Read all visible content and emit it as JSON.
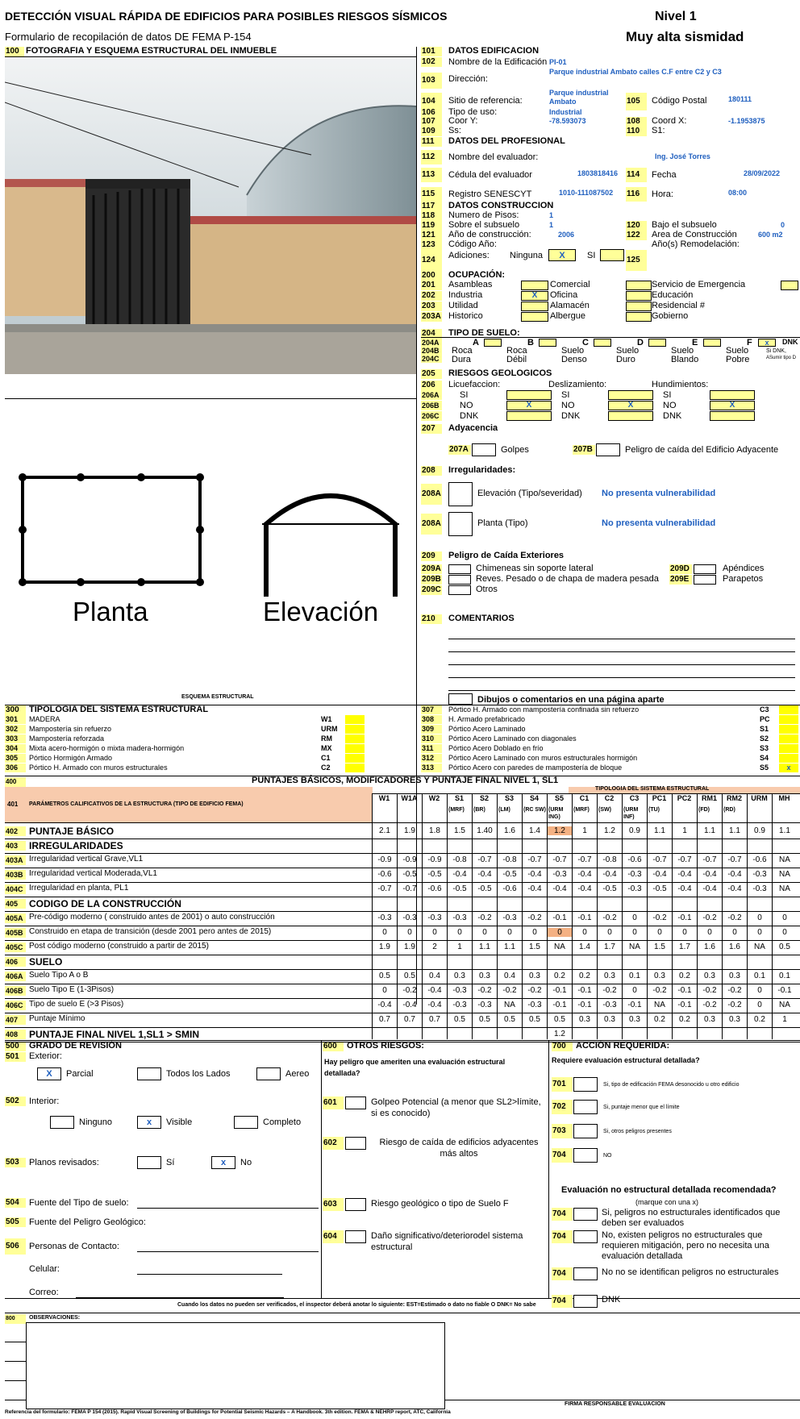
{
  "header": {
    "title": "DETECCIÓN VISUAL RÁPIDA DE EDIFICIOS PARA POSIBLES RIESGOS SÍSMICOS",
    "subtitle": "Formulario de recopilación de datos DE FEMA P-154",
    "level": "Nivel 1",
    "seismicity": "Muy alta sismidad"
  },
  "s100": {
    "num": "100",
    "label": "FOTOGRAFIA Y ESQUEMA ESTRUCTURAL DEL INMUEBLE"
  },
  "sketch": {
    "planta": "Planta",
    "elevacion": "Elevación",
    "caption": "ESQUEMA ESTRUCTURAL"
  },
  "building": {
    "r101": {
      "num": "101",
      "label": "DATOS EDIFICACION"
    },
    "r102": {
      "num": "102",
      "label": "Nombre de la Edificación",
      "value": "PI-01"
    },
    "r103": {
      "num": "103",
      "label": "Dirección:",
      "value": "Parque industrial Ambato calles C.F entre  C2 y C3"
    },
    "r104": {
      "num": "104",
      "label": "Sitio de referencia:",
      "value": "Parque industrial Ambato"
    },
    "r105": {
      "num": "105",
      "label": "Código Postal",
      "value": "180111"
    },
    "r106": {
      "num": "106",
      "label": "Tipo de uso:",
      "value": "Industrial"
    },
    "r107": {
      "num": "107",
      "label": "Coor Y:",
      "value": "-78.593073"
    },
    "r108": {
      "num": "108",
      "label": "Coord X:",
      "value": "-1.1953875"
    },
    "r109": {
      "num": "109",
      "label": "Ss:"
    },
    "r110": {
      "num": "110",
      "label": "S1:"
    }
  },
  "prof": {
    "r111": {
      "num": "111",
      "label": "DATOS DEL PROFESIONAL"
    },
    "r112": {
      "num": "112",
      "label": "Nombre del evaluador:",
      "value": "Ing. José Torres"
    },
    "r113": {
      "num": "113",
      "label": "Cédula del evaluador",
      "value": "1803818416"
    },
    "r114": {
      "num": "114",
      "label": "Fecha",
      "value": "28/09/2022"
    },
    "r115": {
      "num": "115",
      "label": "Registro SENESCYT",
      "value": "1010-111087502"
    },
    "r116": {
      "num": "116",
      "label": "Hora:",
      "value": "08:00"
    }
  },
  "constr": {
    "r117": {
      "num": "117",
      "label": "DATOS CONSTRUCCION"
    },
    "r118": {
      "num": "118",
      "label": "Numero de Pisos:",
      "value": "1"
    },
    "r119": {
      "num": "119",
      "label": "Sobre el subsuelo",
      "value": "1"
    },
    "r120": {
      "num": "120",
      "label": "Bajo el subsuelo",
      "value": "0"
    },
    "r121": {
      "num": "121",
      "label": "Año de construcción:",
      "value": "2006"
    },
    "r122": {
      "num": "122",
      "label": "Area de Construcción",
      "value": "600 m2"
    },
    "r123": {
      "num": "123",
      "label": "Código Año:",
      "extra": "Año(s) Remodelación:"
    },
    "r124": {
      "num": "124",
      "label": "Adiciones:",
      "opt1": "Ninguna",
      "mark1": "X",
      "opt2": "SI"
    },
    "r125": {
      "num": "125"
    }
  },
  "occ": {
    "r200": {
      "num": "200",
      "label": "OCUPACIÓN:"
    },
    "rows": [
      {
        "num": "201",
        "c1": "Asambleas",
        "m1": "",
        "c2": "Comercial",
        "m2": "",
        "c3": "Servicio de  Emergencia"
      },
      {
        "num": "202",
        "c1": "Industria",
        "m1": "X",
        "c2": "Oficina",
        "m2": "",
        "c3": "Educación"
      },
      {
        "num": "203",
        "c1": "Utilidad",
        "m1": "",
        "c2": "Alamacén",
        "m2": "",
        "c3": "Residencial #"
      },
      {
        "num": "203A",
        "c1": "Historico",
        "m1": "",
        "c2": "Albergue",
        "m2": "",
        "c3": "Gobierno"
      }
    ]
  },
  "soil": {
    "r204": {
      "num": "204",
      "label": "TIPO DE SUELO:"
    },
    "nums": [
      "204A",
      "204B",
      "204C"
    ],
    "letters": [
      "A",
      "B",
      "C",
      "D",
      "E",
      "F"
    ],
    "l1": [
      "Roca",
      "Roca",
      "Suelo",
      "Suelo",
      "Suelo",
      "Suelo"
    ],
    "l2": [
      "Dura",
      "Débil",
      "Denso",
      "Duro",
      "Blando",
      "Pobre"
    ],
    "mark": "x",
    "dnk": "DNK",
    "note1": "Si DNK,",
    "note2": "ASumir tipo D"
  },
  "geo": {
    "r205": {
      "num": "205",
      "label": "RIESGOS GEOLOGICOS"
    },
    "r206": {
      "num": "206",
      "h1": "Licuefaccion:",
      "h2": "Deslizamiento:",
      "h3": "Hundimientos:"
    },
    "rows": [
      {
        "num": "206A",
        "v": "SI",
        "m": ""
      },
      {
        "num": "206B",
        "v": "NO",
        "m": "X"
      },
      {
        "num": "206C",
        "v": "DNK",
        "m": ""
      }
    ]
  },
  "adj": {
    "r207": {
      "num": "207",
      "label": "Adyacencia"
    },
    "a": "207A",
    "alabel": "Golpes",
    "b": "207B",
    "blabel": "Peligro de caída del Edificio Adyacente"
  },
  "irr": {
    "r208": {
      "num": "208",
      "label": "Irregularidades:"
    },
    "n1": "208A",
    "l1": "Elevación (Tipo/severidad)",
    "v1": "No presenta vulnerabilidad",
    "n2": "208A",
    "l2": "Planta (Tipo)",
    "v2": "No presenta vulnerabilidad"
  },
  "ext": {
    "r209": {
      "num": "209",
      "label": "Peligro de Caída Exteriores"
    },
    "rows": [
      {
        "n": "209A",
        "l": "Chimeneas sin soporte lateral",
        "n2": "209D",
        "l2": "Apéndices"
      },
      {
        "n": "209B",
        "l": "Reves. Pesado o de chapa de madera pesada",
        "n2": "209E",
        "l2": "Parapetos"
      },
      {
        "n": "209C",
        "l": "Otros",
        "n2": "",
        "l2": ""
      }
    ]
  },
  "comm": {
    "num": "210",
    "label": "COMENTARIOS",
    "sep": "Dibujos o comentarios en una página aparte"
  },
  "typ": {
    "r300": {
      "num": "300",
      "label": "TIPOLOGIA DEL SISTEMA ESTRUCTURAL"
    },
    "left": [
      {
        "n": "301",
        "l": "MADERA",
        "c": "W1"
      },
      {
        "n": "302",
        "l": "Mampostería sin refuerzo",
        "c": "URM"
      },
      {
        "n": "303",
        "l": "Mampostería reforzada",
        "c": "RM"
      },
      {
        "n": "304",
        "l": "Mixta acero-hormigón o mixta madera-hormigón",
        "c": "MX"
      },
      {
        "n": "305",
        "l": "Pórtico Hormigón Armado",
        "c": "C1"
      },
      {
        "n": "306",
        "l": "Pórtico H. Armado con muros estructurales",
        "c": "C2"
      }
    ],
    "right": [
      {
        "n": "307",
        "l": "Pórtico H. Armado con mampostería confinada sin refuerzo",
        "c": "C3",
        "m": ""
      },
      {
        "n": "308",
        "l": "H. Armado prefabricado",
        "c": "PC",
        "m": ""
      },
      {
        "n": "309",
        "l": "Pórtico Acero Laminado",
        "c": "S1",
        "m": ""
      },
      {
        "n": "310",
        "l": "Pórtico Acero Laminado con diagonales",
        "c": "S2",
        "m": ""
      },
      {
        "n": "311",
        "l": "Pórtico Acero Doblado en frío",
        "c": "S3",
        "m": ""
      },
      {
        "n": "312",
        "l": "Pórtico Acero Laminado con muros estructurales hormigón",
        "c": "S4",
        "m": ""
      },
      {
        "n": "313",
        "l": "Pórtico Acero con paredes de mampostería de bloque",
        "c": "S5",
        "m": "x"
      }
    ]
  },
  "scores": {
    "r400": {
      "num": "400",
      "label": "PUNTAJES BÁSICOS, MODIFICADORES Y PUNTAJE FINAL NIVEL 1,  SL1"
    },
    "r401": {
      "num": "401",
      "label": "PARÁMETROS CALIFICATIVOS DE LA ESTRUCTURA (TIPO DE EDIFICIO FEMA)",
      "group": "TIPOLOGIA DEL SISTEMA ESTRUCTURAL"
    },
    "cols": [
      "W1",
      "W1A",
      "W2",
      "S1",
      "S2",
      "S3",
      "S4",
      "S5",
      "C1",
      "C2",
      "C3",
      "PC1",
      "PC2",
      "RM1",
      "RM2",
      "URM",
      "MH"
    ],
    "subs": [
      "",
      "",
      "",
      "(MRF)",
      "(BR)",
      "(LM)",
      "(RC SW)",
      "(URM ING)",
      "(MRF)",
      "(SW)",
      "(URM INF)",
      "(TU)",
      "",
      "(FD)",
      "(RD)",
      "",
      ""
    ],
    "rows": [
      {
        "num": "402",
        "label": "PUNTAJE BÁSICO",
        "bold": true,
        "v": [
          "2.1",
          "1.9",
          "1.8",
          "1.5",
          "1.40",
          "1.6",
          "1.4",
          "1.2",
          "1",
          "1.2",
          "0.9",
          "1.1",
          "1",
          "1.1",
          "1.1",
          "0.9",
          "1.1"
        ]
      },
      {
        "num": "403",
        "label": "IRREGULARIDADES",
        "bold": true,
        "v": []
      },
      {
        "num": "403A",
        "label": "Irregularidad vertical Grave,VL1",
        "v": [
          "-0.9",
          "-0.9",
          "-0.9",
          "-0.8",
          "-0.7",
          "-0.8",
          "-0.7",
          "-0.7",
          "-0.7",
          "-0.8",
          "-0.6",
          "-0.7",
          "-0.7",
          "-0.7",
          "-0.7",
          "-0.6",
          "NA"
        ]
      },
      {
        "num": "403B",
        "label": "Irregularidad vertical Moderada,VL1",
        "v": [
          "-0.6",
          "-0.5",
          "-0.5",
          "-0.4",
          "-0.4",
          "-0.5",
          "-0.4",
          "-0.3",
          "-0.4",
          "-0.4",
          "-0.3",
          "-0.4",
          "-0.4",
          "-0.4",
          "-0.4",
          "-0.3",
          "NA"
        ]
      },
      {
        "num": "404C",
        "label": "Irregularidad en planta, PL1",
        "v": [
          "-0.7",
          "-0.7",
          "-0.6",
          "-0.5",
          "-0.5",
          "-0.6",
          "-0.4",
          "-0.4",
          "-0.4",
          "-0.5",
          "-0.3",
          "-0.5",
          "-0.4",
          "-0.4",
          "-0.4",
          "-0.3",
          "NA"
        ]
      },
      {
        "num": "405",
        "label": "CODIGO DE LA CONSTRUCCIÓN",
        "bold": true,
        "v": []
      },
      {
        "num": "405A",
        "label": "Pre-código moderno ( construido antes de 2001) o auto construcción",
        "v": [
          "-0.3",
          "-0.3",
          "-0.3",
          "-0.3",
          "-0.2",
          "-0.3",
          "-0.2",
          "-0.1",
          "-0.1",
          "-0.2",
          "0",
          "-0.2",
          "-0.1",
          "-0.2",
          "-0.2",
          "0",
          "0"
        ]
      },
      {
        "num": "405B",
        "label": "Construido en etapa de transición (desde 2001 pero antes de 2015)",
        "v": [
          "0",
          "0",
          "0",
          "0",
          "0",
          "0",
          "0",
          "0",
          "0",
          "0",
          "0",
          "0",
          "0",
          "0",
          "0",
          "0",
          "0"
        ]
      },
      {
        "num": "405C",
        "label": "Post código moderno (construido a partir de 2015)",
        "v": [
          "1.9",
          "1.9",
          "2",
          "1",
          "1.1",
          "1.1",
          "1.5",
          "NA",
          "1.4",
          "1.7",
          "NA",
          "1.5",
          "1.7",
          "1.6",
          "1.6",
          "NA",
          "0.5"
        ]
      },
      {
        "num": "406",
        "label": "SUELO",
        "bold": true,
        "v": []
      },
      {
        "num": "406A",
        "label": "Suelo Tipo A o B",
        "v": [
          "0.5",
          "0.5",
          "0.4",
          "0.3",
          "0.3",
          "0.4",
          "0.3",
          "0.2",
          "0.2",
          "0.3",
          "0.1",
          "0.3",
          "0.2",
          "0.3",
          "0.3",
          "0.1",
          "0.1"
        ]
      },
      {
        "num": "406B",
        "label": "Suelo Tipo E (1-3Pisos)",
        "v": [
          "0",
          "-0.2",
          "-0.4",
          "-0.3",
          "-0.2",
          "-0.2",
          "-0.2",
          "-0.1",
          "-0.1",
          "-0.2",
          "0",
          "-0.2",
          "-0.1",
          "-0.2",
          "-0.2",
          "0",
          "-0.1"
        ]
      },
      {
        "num": "406C",
        "label": "Tipo de suelo E (>3 Pisos)",
        "v": [
          "-0.4",
          "-0.4",
          "-0.4",
          "-0.3",
          "-0.3",
          "NA",
          "-0.3",
          "-0.1",
          "-0.1",
          "-0.3",
          "-0.1",
          "NA",
          "-0.1",
          "-0.2",
          "-0.2",
          "0",
          "NA"
        ]
      },
      {
        "num": "407",
        "label": "Puntaje Mínimo",
        "v": [
          "0.7",
          "0.7",
          "0.7",
          "0.5",
          "0.5",
          "0.5",
          "0.5",
          "0.5",
          "0.3",
          "0.3",
          "0.3",
          "0.2",
          "0.2",
          "0.3",
          "0.3",
          "0.2",
          "1"
        ]
      },
      {
        "num": "408",
        "label": "PUNTAJE FINAL NIVEL 1,SL1 > SMIN",
        "bold": true,
        "v": [
          "",
          "",
          "",
          "",
          "",
          "",
          "",
          "1.2",
          "",
          "",
          "",
          "",
          "",
          "",
          "",
          "",
          ""
        ]
      }
    ]
  },
  "rev": {
    "r500": {
      "num": "500",
      "label": "GRADO DE REVISIÓN"
    },
    "r501": {
      "num": "501",
      "label": "Exterior:"
    },
    "ext": [
      {
        "m": "X",
        "l": "Parcial"
      },
      {
        "m": "",
        "l": "Todos los Lados"
      },
      {
        "m": "",
        "l": "Aereo"
      }
    ],
    "r502": {
      "num": "502",
      "label": "Interior:"
    },
    "int": [
      {
        "m": "",
        "l": "Ninguno"
      },
      {
        "m": "x",
        "l": "Visible"
      },
      {
        "m": "",
        "l": "Completo"
      }
    ],
    "r503": {
      "num": "503",
      "label": "Planos revisados:"
    },
    "planos": [
      {
        "m": "",
        "l": "Sí"
      },
      {
        "m": "x",
        "l": "No"
      }
    ],
    "r504": {
      "num": "504",
      "label": "Fuente del Tipo de suelo:"
    },
    "r505": {
      "num": "505",
      "label": "Fuente del Peligro Geológico:"
    },
    "r506": {
      "num": "506",
      "label": "Personas de Contacto:"
    },
    "cel": "Celular:",
    "mail": "Correo:"
  },
  "other": {
    "r600": {
      "num": "600",
      "label": "OTROS RIESGOS:"
    },
    "q": "Hay peligro que ameriten una evaluación estructural detallada?",
    "items": [
      {
        "n": "601",
        "l": "Golpeo Potencial (a menor que SL2>límite, si es conocido)"
      },
      {
        "n": "602",
        "l": "Riesgo de caída de edificios adyacentes más altos"
      },
      {
        "n": "603",
        "l": "Riesgo geológico o tipo de Suelo F"
      },
      {
        "n": "604",
        "l": "Daño significativo/deteriorodel sistema estructural"
      }
    ]
  },
  "action": {
    "r700": {
      "num": "700",
      "label": "ACCIÓN REQUERIDA:"
    },
    "q": "Requiere evaluación estructural detallada?",
    "items": [
      {
        "n": "701",
        "l": "Si, tipo de edificación FEMA desonocido u otro edificio"
      },
      {
        "n": "702",
        "l": "Si, puntaje menor que el límite"
      },
      {
        "n": "703",
        "l": "Si, otros peligros presentes"
      },
      {
        "n": "704",
        "l": "NO"
      }
    ],
    "q2": "Evaluación no estructural detallada recomendada?",
    "q2b": "(marque con una x)",
    "items2": [
      {
        "n": "704",
        "l": "Si, peligros no estructurales identificados que deben ser evaluados"
      },
      {
        "n": "704",
        "l": "No, existen peligros no estructurales que requieren mitigación, pero no necesita una evaluación detallada"
      },
      {
        "n": "704",
        "l": "No no se identifican peligros no estructurales"
      },
      {
        "n": "704",
        "l": "DNK"
      }
    ]
  },
  "footer": {
    "note": "Cuando los datos no pueden ser verificados, el inspector deberá anotar lo siguiente: EST=Estimado o dato no fiable O DNK= No sabe",
    "r800": {
      "num": "800",
      "label": "OBSERVACIONES:"
    },
    "firma": "FIRMA  RESPONSABLE EVALUACION",
    "ref": "Referencia del formulario: FEMA P 154 (2015). Rapid Visual Screening of Buildings for Potential Seismic Hazards – A Handbook. 3th edition. FEMA & NEHRP report, ATC, California"
  }
}
